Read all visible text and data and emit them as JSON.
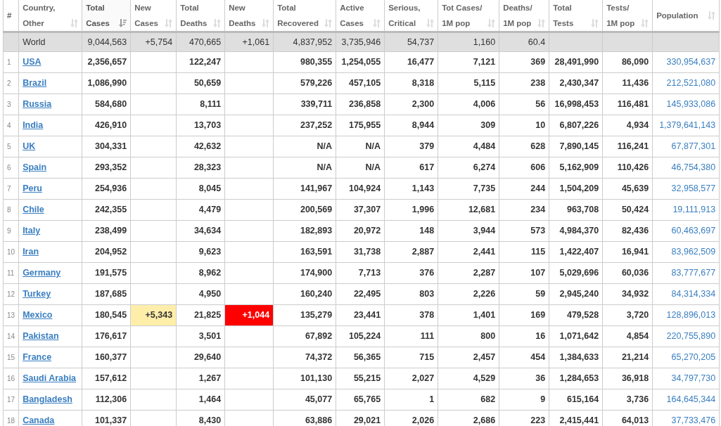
{
  "table": {
    "columns": [
      {
        "label": [
          "#"
        ],
        "sortable": false,
        "sorted": false
      },
      {
        "label": [
          "Country,",
          "Other"
        ],
        "sortable": true,
        "sorted": false
      },
      {
        "label": [
          "Total",
          "Cases"
        ],
        "sortable": true,
        "sorted": true
      },
      {
        "label": [
          "New",
          "Cases"
        ],
        "sortable": true,
        "sorted": false
      },
      {
        "label": [
          "Total",
          "Deaths"
        ],
        "sortable": true,
        "sorted": false
      },
      {
        "label": [
          "New",
          "Deaths"
        ],
        "sortable": true,
        "sorted": false
      },
      {
        "label": [
          "Total",
          "Recovered"
        ],
        "sortable": true,
        "sorted": false
      },
      {
        "label": [
          "Active",
          "Cases"
        ],
        "sortable": true,
        "sorted": false
      },
      {
        "label": [
          "Serious,",
          "Critical"
        ],
        "sortable": true,
        "sorted": false
      },
      {
        "label": [
          "Tot Cases/",
          "1M pop"
        ],
        "sortable": true,
        "sorted": false
      },
      {
        "label": [
          "Deaths/",
          "1M pop"
        ],
        "sortable": true,
        "sorted": false
      },
      {
        "label": [
          "Total",
          "Tests"
        ],
        "sortable": true,
        "sorted": false
      },
      {
        "label": [
          "Tests/",
          "1M pop"
        ],
        "sortable": true,
        "sorted": false
      },
      {
        "label": [
          "Population"
        ],
        "sortable": true,
        "sorted": false
      }
    ],
    "rows": [
      {
        "kind": "total",
        "cells": [
          null,
          "World",
          "9,044,563",
          "+5,754",
          "470,665",
          "+1,061",
          "4,837,952",
          "3,735,946",
          "54,737",
          "1,160",
          "60.4",
          null,
          null,
          null
        ]
      },
      {
        "kind": "country",
        "cells": [
          "1",
          "USA",
          "2,356,657",
          null,
          "122,247",
          null,
          "980,355",
          "1,254,055",
          "16,477",
          "7,121",
          "369",
          "28,491,990",
          "86,090",
          "330,954,637"
        ]
      },
      {
        "kind": "country",
        "cells": [
          "2",
          "Brazil",
          "1,086,990",
          null,
          "50,659",
          null,
          "579,226",
          "457,105",
          "8,318",
          "5,115",
          "238",
          "2,430,347",
          "11,436",
          "212,521,080"
        ]
      },
      {
        "kind": "country",
        "cells": [
          "3",
          "Russia",
          "584,680",
          null,
          "8,111",
          null,
          "339,711",
          "236,858",
          "2,300",
          "4,006",
          "56",
          "16,998,453",
          "116,481",
          "145,933,086"
        ]
      },
      {
        "kind": "country",
        "cells": [
          "4",
          "India",
          "426,910",
          null,
          "13,703",
          null,
          "237,252",
          "175,955",
          "8,944",
          "309",
          "10",
          "6,807,226",
          "4,934",
          "1,379,641,143"
        ]
      },
      {
        "kind": "country",
        "cells": [
          "5",
          "UK",
          "304,331",
          null,
          "42,632",
          null,
          "N/A",
          "N/A",
          "379",
          "4,484",
          "628",
          "7,890,145",
          "116,241",
          "67,877,301"
        ]
      },
      {
        "kind": "country",
        "cells": [
          "6",
          "Spain",
          "293,352",
          null,
          "28,323",
          null,
          "N/A",
          "N/A",
          "617",
          "6,274",
          "606",
          "5,162,909",
          "110,426",
          "46,754,380"
        ]
      },
      {
        "kind": "country",
        "cells": [
          "7",
          "Peru",
          "254,936",
          null,
          "8,045",
          null,
          "141,967",
          "104,924",
          "1,143",
          "7,735",
          "244",
          "1,504,209",
          "45,639",
          "32,958,577"
        ]
      },
      {
        "kind": "country",
        "cells": [
          "8",
          "Chile",
          "242,355",
          null,
          "4,479",
          null,
          "200,569",
          "37,307",
          "1,996",
          "12,681",
          "234",
          "963,708",
          "50,424",
          "19,111,913"
        ]
      },
      {
        "kind": "country",
        "cells": [
          "9",
          "Italy",
          "238,499",
          null,
          "34,634",
          null,
          "182,893",
          "20,972",
          "148",
          "3,944",
          "573",
          "4,984,370",
          "82,436",
          "60,463,697"
        ]
      },
      {
        "kind": "country",
        "cells": [
          "10",
          "Iran",
          "204,952",
          null,
          "9,623",
          null,
          "163,591",
          "31,738",
          "2,887",
          "2,441",
          "115",
          "1,422,407",
          "16,941",
          "83,962,509"
        ]
      },
      {
        "kind": "country",
        "cells": [
          "11",
          "Germany",
          "191,575",
          null,
          "8,962",
          null,
          "174,900",
          "7,713",
          "376",
          "2,287",
          "107",
          "5,029,696",
          "60,036",
          "83,777,677"
        ]
      },
      {
        "kind": "country",
        "cells": [
          "12",
          "Turkey",
          "187,685",
          null,
          "4,950",
          null,
          "160,240",
          "22,495",
          "803",
          "2,226",
          "59",
          "2,945,240",
          "34,932",
          "84,314,334"
        ]
      },
      {
        "kind": "country",
        "cells": [
          "13",
          "Mexico",
          "180,545",
          "+5,343",
          "21,825",
          "+1,044",
          "135,279",
          "23,441",
          "378",
          "1,401",
          "169",
          "479,528",
          "3,720",
          "128,896,013"
        ]
      },
      {
        "kind": "country",
        "cells": [
          "14",
          "Pakistan",
          "176,617",
          null,
          "3,501",
          null,
          "67,892",
          "105,224",
          "111",
          "800",
          "16",
          "1,071,642",
          "4,854",
          "220,755,890"
        ]
      },
      {
        "kind": "country",
        "cells": [
          "15",
          "France",
          "160,377",
          null,
          "29,640",
          null,
          "74,372",
          "56,365",
          "715",
          "2,457",
          "454",
          "1,384,633",
          "21,214",
          "65,270,205"
        ]
      },
      {
        "kind": "country",
        "cells": [
          "16",
          "Saudi Arabia",
          "157,612",
          null,
          "1,267",
          null,
          "101,130",
          "55,215",
          "2,027",
          "4,529",
          "36",
          "1,284,653",
          "36,918",
          "34,797,730"
        ]
      },
      {
        "kind": "country",
        "cells": [
          "17",
          "Bangladesh",
          "112,306",
          null,
          "1,464",
          null,
          "45,077",
          "65,765",
          "1",
          "682",
          "9",
          "615,164",
          "3,736",
          "164,645,344"
        ]
      },
      {
        "kind": "country",
        "cells": [
          "18",
          "Canada",
          "101,337",
          null,
          "8,430",
          null,
          "63,886",
          "29,021",
          "2,026",
          "2,686",
          "223",
          "2,415,441",
          "64,013",
          "37,733,476"
        ]
      }
    ]
  }
}
